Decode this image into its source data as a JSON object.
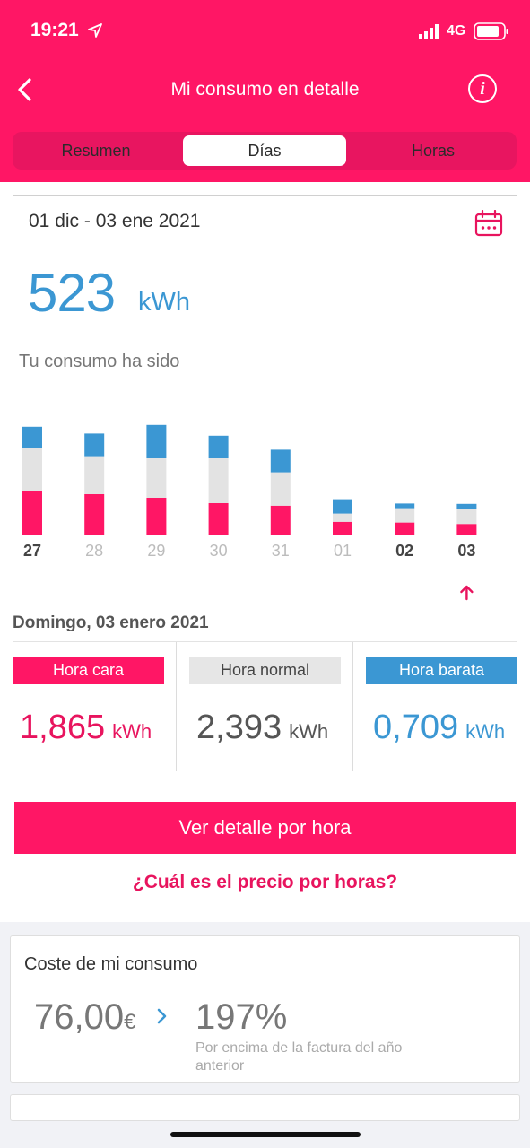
{
  "status_bar": {
    "time": "19:21",
    "network": "4G"
  },
  "nav": {
    "title": "Mi consumo en detalle",
    "info_label": "i"
  },
  "tabs": [
    {
      "label": "Resumen",
      "selected": false
    },
    {
      "label": "Días",
      "selected": true
    },
    {
      "label": "Horas",
      "selected": false
    }
  ],
  "period": {
    "range": "01 dic - 03 ene 2021",
    "total_value": "523",
    "total_unit": "kWh"
  },
  "chart_subtitle": "Tu consumo ha sido",
  "colors": {
    "expensive": "#ff1665",
    "normal": "#e3e3e3",
    "cheap": "#3b97d3",
    "brand": "#ff1665"
  },
  "chart_data": {
    "type": "bar",
    "stacked": true,
    "categories": [
      "27",
      "28",
      "29",
      "30",
      "31",
      "01",
      "02",
      "03"
    ],
    "series": [
      {
        "name": "Hora cara",
        "color": "#ff1665",
        "values": [
          12.3,
          11.5,
          10.5,
          9,
          8.3,
          3.8,
          3.6,
          3.2
        ]
      },
      {
        "name": "Hora normal",
        "color": "#e3e3e3",
        "values": [
          12,
          10.6,
          11,
          12.5,
          9.3,
          2.3,
          4,
          4.2
        ]
      },
      {
        "name": "Hora barata",
        "color": "#3b97d3",
        "values": [
          6,
          6.3,
          9.3,
          6.3,
          6.3,
          4,
          1.3,
          1.4
        ]
      }
    ],
    "highlight_labels": [
      "27",
      "02",
      "03"
    ],
    "selected": "03"
  },
  "selected_day": {
    "title": "Domingo, 03 enero 2021",
    "slots": [
      {
        "label": "Hora cara",
        "value": "1,865",
        "unit": "kWh"
      },
      {
        "label": "Hora normal",
        "value": "2,393",
        "unit": "kWh"
      },
      {
        "label": "Hora barata",
        "value": "0,709",
        "unit": "kWh"
      }
    ]
  },
  "cta_label": "Ver detalle por hora",
  "price_link": "¿Cuál es el precio por horas?",
  "cost_card": {
    "title": "Coste de mi consumo",
    "amount": "76,00",
    "currency": "€",
    "percent": "197%",
    "note": "Por encima de la factura del año anterior"
  }
}
